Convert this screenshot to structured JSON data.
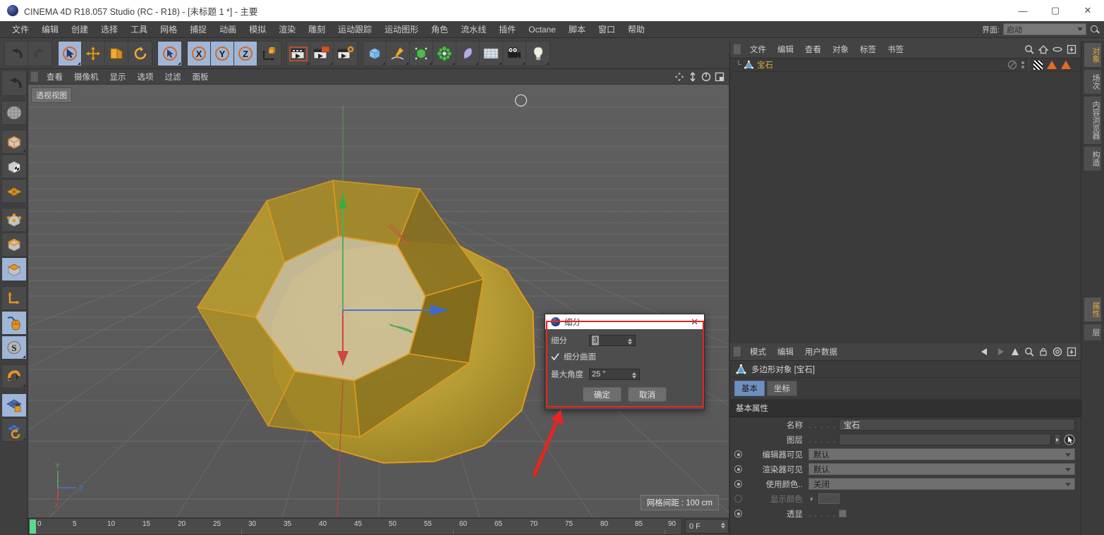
{
  "titlebar": {
    "title": "CINEMA 4D R18.057 Studio (RC - R18) - [未标题 1 *] - 主要",
    "minimize": "—",
    "maximize": "▢",
    "close": "✕"
  },
  "menubar": {
    "items": [
      "文件",
      "编辑",
      "创建",
      "选择",
      "工具",
      "网格",
      "捕捉",
      "动画",
      "模拟",
      "渲染",
      "雕刻",
      "运动跟踪",
      "运动图形",
      "角色",
      "流水线",
      "插件",
      "Octane",
      "脚本",
      "窗口",
      "帮助"
    ],
    "interface_label": "界面:",
    "interface_value": "启动"
  },
  "toolbar": {
    "groups": [
      {
        "name": "undo-redo",
        "buttons": [
          {
            "name": "undo-button",
            "icon": "undo-icon"
          },
          {
            "name": "redo-button",
            "icon": "redo-icon"
          }
        ]
      },
      {
        "name": "select-tools",
        "buttons": [
          {
            "name": "live-selection-button",
            "icon": "live-selection-icon"
          },
          {
            "name": "move-button",
            "icon": "move-icon"
          },
          {
            "name": "scale-button",
            "icon": "scale-icon"
          },
          {
            "name": "rotate-button",
            "icon": "rotate-icon"
          }
        ]
      },
      {
        "name": "select-mode",
        "buttons": [
          {
            "name": "selection-mode-button",
            "icon": "arrow-circle-icon"
          }
        ]
      },
      {
        "name": "axis-locks",
        "buttons": [
          {
            "name": "lock-x-button",
            "icon": "axis-x-icon",
            "label": "X"
          },
          {
            "name": "lock-y-button",
            "icon": "axis-y-icon",
            "label": "Y"
          },
          {
            "name": "lock-z-button",
            "icon": "axis-z-icon",
            "label": "Z"
          },
          {
            "name": "world-object-coord-button",
            "icon": "world-coord-icon"
          }
        ]
      },
      {
        "name": "render-tools",
        "buttons": [
          {
            "name": "render-view-button",
            "icon": "render-view-icon"
          },
          {
            "name": "render-region-button",
            "icon": "render-region-icon"
          },
          {
            "name": "render-settings-button",
            "icon": "render-settings-icon"
          }
        ]
      },
      {
        "name": "create-objects",
        "buttons": [
          {
            "name": "add-cube-button",
            "icon": "cube-icon"
          },
          {
            "name": "add-spline-button",
            "icon": "pen-spline-icon"
          },
          {
            "name": "add-nurbs-button",
            "icon": "nurbs-icon"
          },
          {
            "name": "add-array-button",
            "icon": "array-icon"
          },
          {
            "name": "add-deformer-button",
            "icon": "bend-deformer-icon"
          },
          {
            "name": "add-floor-button",
            "icon": "floor-icon"
          },
          {
            "name": "add-camera-button",
            "icon": "camera-icon"
          },
          {
            "name": "add-light-button",
            "icon": "light-bulb-icon"
          }
        ]
      }
    ]
  },
  "left_toolbar": {
    "buttons": [
      {
        "name": "undo-tool-button",
        "icon": "undo-icon"
      },
      {
        "name": "make-editable-button",
        "icon": "make-editable-icon"
      },
      {
        "name": "model-mode-button",
        "icon": "model-mode-icon"
      },
      {
        "name": "texture-mode-button",
        "icon": "texture-mode-icon"
      },
      {
        "name": "workplane-mode-button",
        "icon": "workplane-icon"
      },
      {
        "name": "point-mode-button",
        "icon": "point-mode-icon"
      },
      {
        "name": "edge-mode-button",
        "icon": "edge-mode-icon"
      },
      {
        "name": "polygon-mode-button",
        "icon": "polygon-mode-icon"
      },
      {
        "name": "axis-mode-button",
        "icon": "axis-mode-icon"
      },
      {
        "name": "enable-tweak-button",
        "icon": "tweak-mouse-icon"
      },
      {
        "name": "soft-selection-button",
        "icon": "soft-selection-s-icon"
      },
      {
        "name": "snap-button",
        "icon": "magnet-snap-icon"
      },
      {
        "name": "lock-workplane-button",
        "icon": "workplane-lock-icon"
      },
      {
        "name": "planar-workplane-button",
        "icon": "workplane-rotate-icon"
      }
    ]
  },
  "viewport": {
    "menu": [
      "查看",
      "摄像机",
      "显示",
      "选项",
      "过滤",
      "面板"
    ],
    "label": "透视视图",
    "grid_info": "网格间距 : 100 cm",
    "axis_labels": {
      "x": "X",
      "y": "Y",
      "z": "Z"
    },
    "nav_icons": [
      "pan-icon",
      "dolly-icon",
      "orbit-icon",
      "maximize-viewport-icon"
    ]
  },
  "timeline": {
    "ticks": [
      "0",
      "5",
      "10",
      "15",
      "20",
      "25",
      "30",
      "35",
      "40",
      "45",
      "50",
      "55",
      "60",
      "65",
      "70",
      "75",
      "80",
      "85",
      "90"
    ],
    "current_frame": "0 F"
  },
  "object_manager": {
    "menu": [
      "文件",
      "编辑",
      "查看",
      "对象",
      "标签",
      "书签"
    ],
    "icons": [
      "search-icon",
      "home-icon",
      "ellipse-icon",
      "add-layer-icon"
    ],
    "objects": [
      {
        "name": "宝石",
        "icon": "polygon-object-icon",
        "tags": [
          "checker-tag-icon",
          "orange-triangle-tag-icon",
          "orange-triangle-tag-icon"
        ]
      }
    ]
  },
  "attribute_manager": {
    "menu": [
      "模式",
      "编辑",
      "用户数据"
    ],
    "icons": [
      "back-arrow-icon",
      "pin-arrow-icon",
      "up-arrow-icon",
      "search-icon",
      "lock-icon",
      "target-icon",
      "add-icon"
    ],
    "object_type": "多边形对象 [宝石]",
    "tabs": [
      {
        "label": "基本",
        "active": true
      },
      {
        "label": "坐标",
        "active": false
      }
    ],
    "section_title": "基本属性",
    "rows": [
      {
        "label": "名称",
        "dots": ". . . . .",
        "type": "text",
        "value": "宝石",
        "radio": null
      },
      {
        "label": "图层",
        "dots": ". . . . .",
        "type": "layer",
        "value": "",
        "radio": null
      },
      {
        "label": "编辑器可见",
        "dots": "",
        "type": "dropdown",
        "value": "默认",
        "radio": "on"
      },
      {
        "label": "渲染器可见",
        "dots": "",
        "type": "dropdown",
        "value": "默认",
        "radio": "on"
      },
      {
        "label": "使用颜色..",
        "dots": "",
        "type": "dropdown",
        "value": "关闭",
        "radio": "on"
      },
      {
        "label": "显示颜色",
        "dots": "",
        "type": "swatch",
        "value": "",
        "radio": "off",
        "dim": true
      },
      {
        "label": "透显",
        "dots": ". . . . .",
        "type": "checkbox",
        "value": "",
        "radio": "on"
      }
    ]
  },
  "vertical_tabs": {
    "top": [
      {
        "label": "对象",
        "active": true
      },
      {
        "label": "场次",
        "active": false
      },
      {
        "label": "内容浏览器",
        "active": false
      },
      {
        "label": "构造",
        "active": false
      }
    ],
    "bottom": [
      {
        "label": "属性",
        "active": true
      },
      {
        "label": "层",
        "active": false
      }
    ]
  },
  "dialog": {
    "title": "细分",
    "close": "✕",
    "subdivide_label": "细分",
    "subdivide_value": "3",
    "hn_checkbox_label": "细分曲面",
    "hn_checked": true,
    "max_angle_label": "最大角度",
    "max_angle_value": "25 °",
    "ok_label": "确定",
    "cancel_label": "取消"
  },
  "annotation": {
    "highlight_color": "#e8251f",
    "arrow_color": "#e8251f"
  }
}
